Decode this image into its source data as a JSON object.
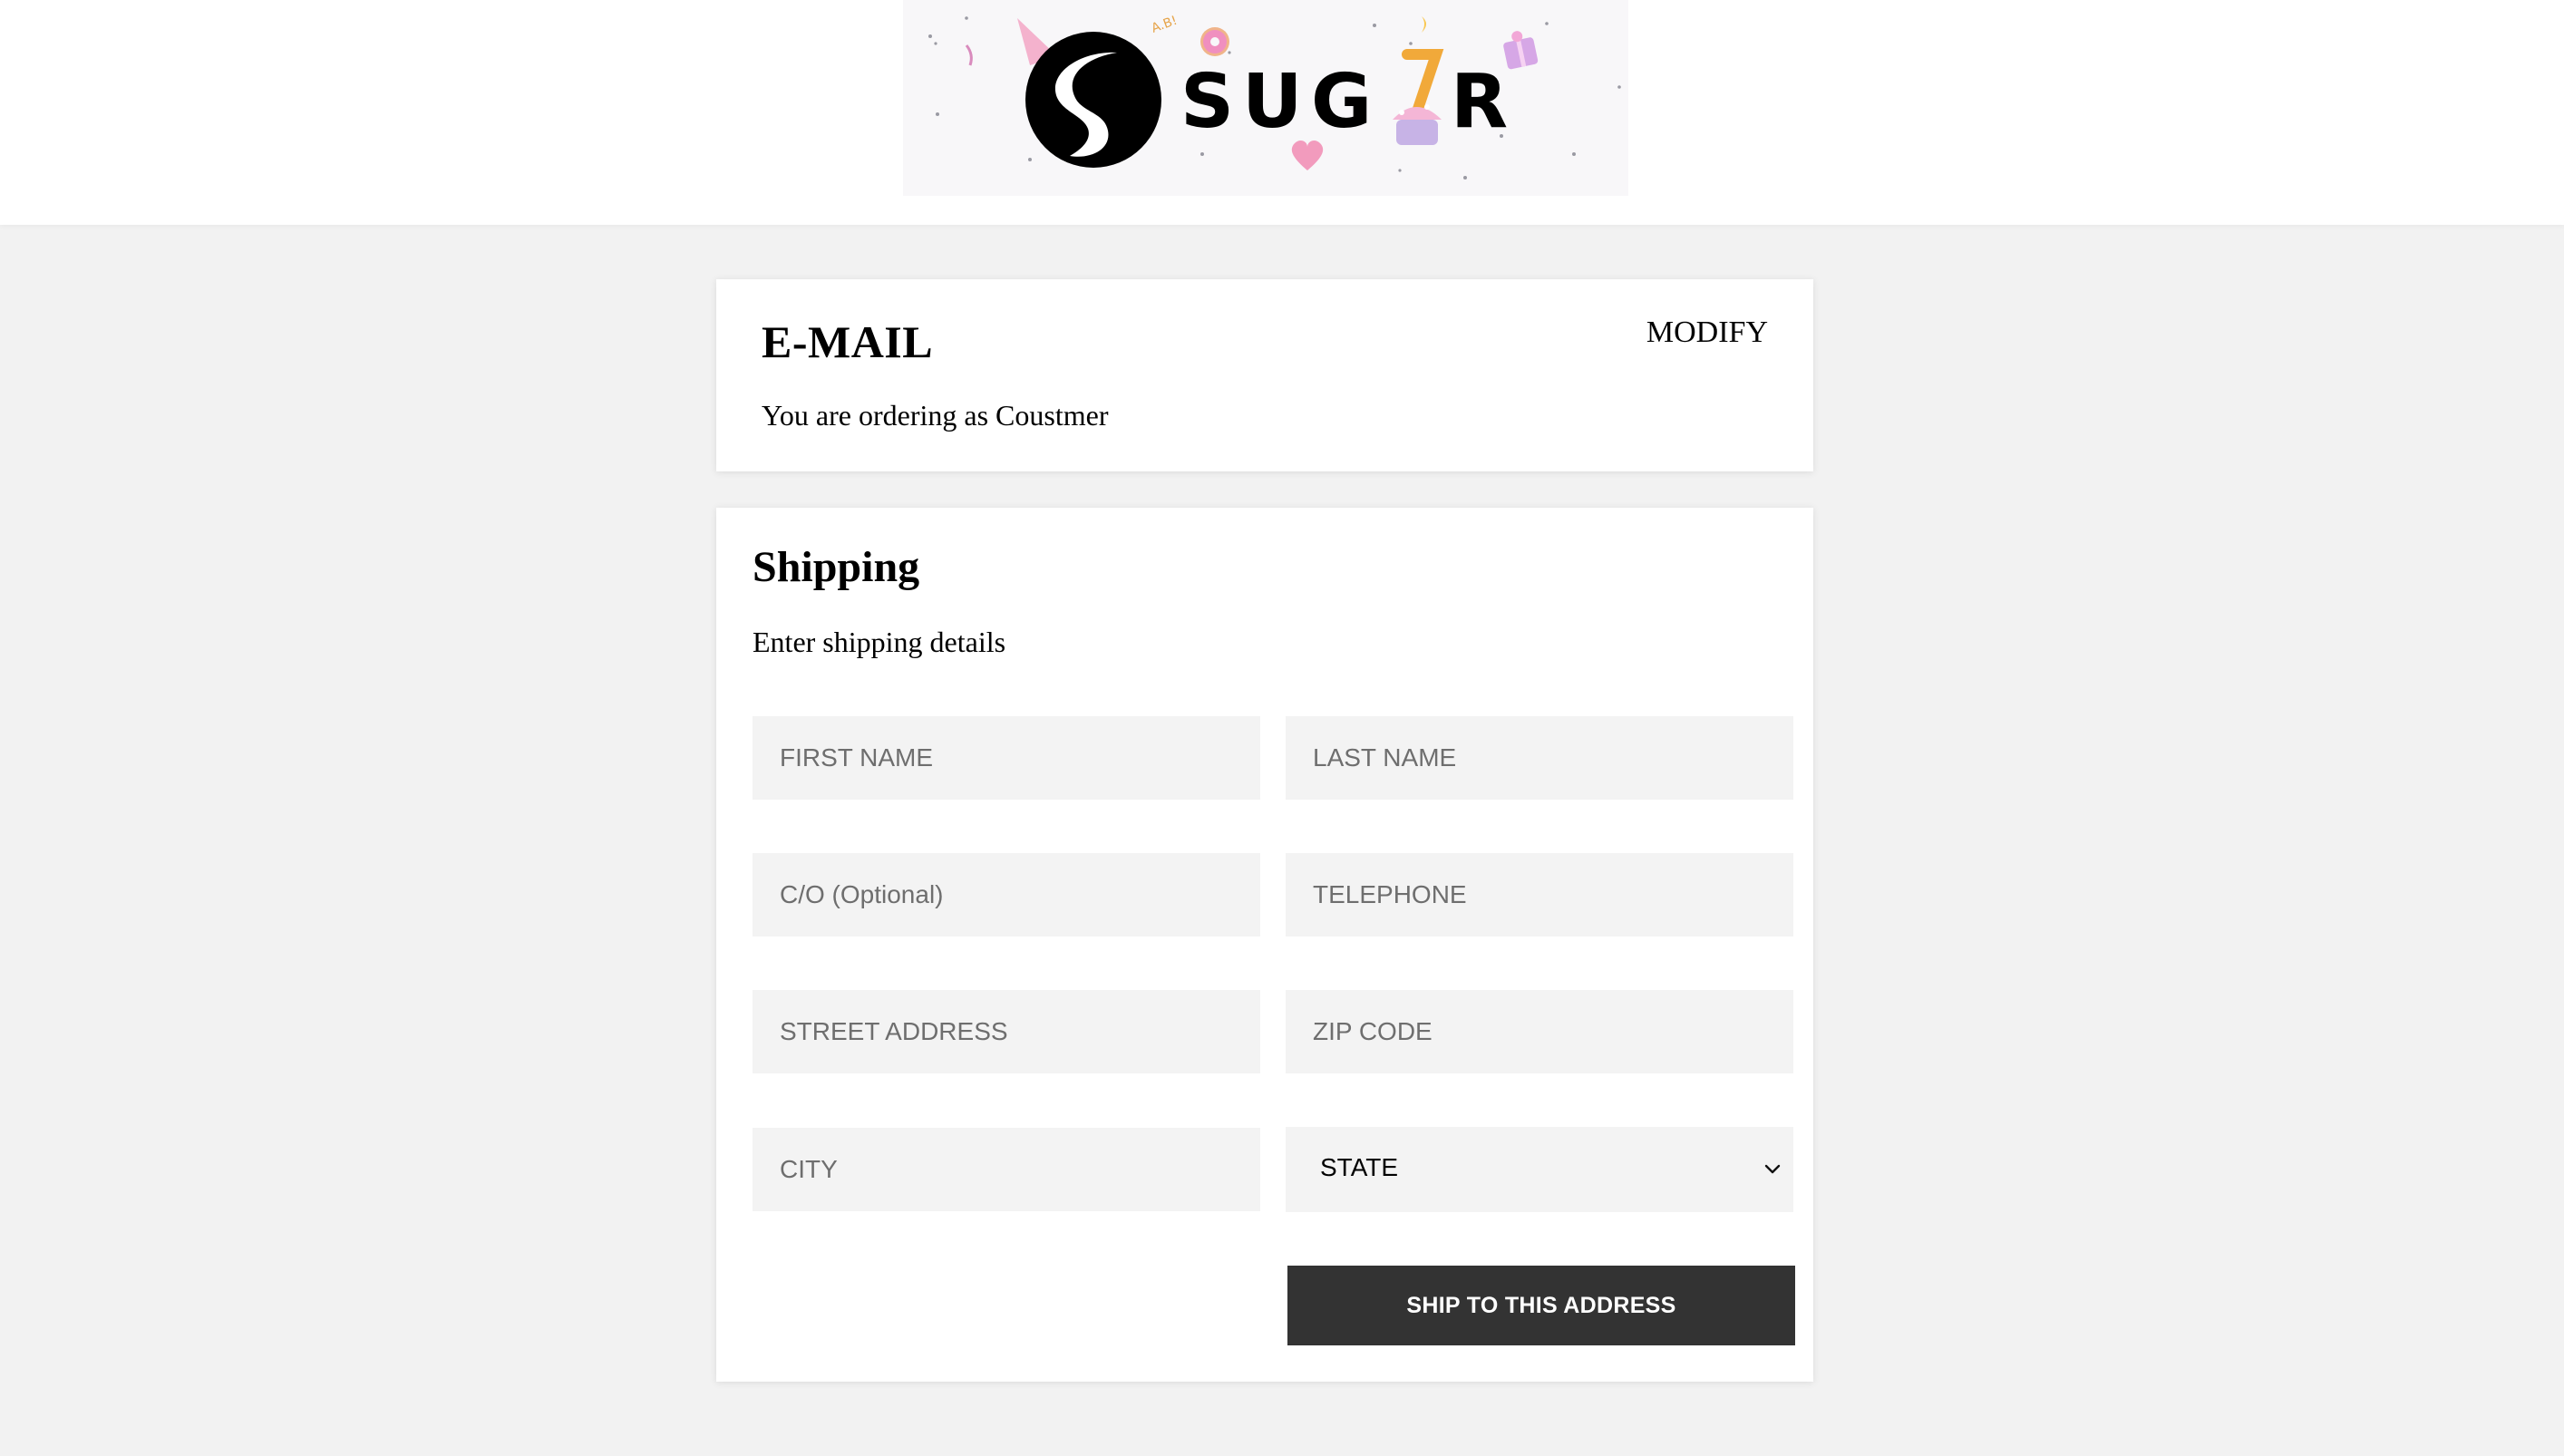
{
  "header": {
    "brand_letters": [
      "S",
      "U",
      "G",
      "R"
    ],
    "logo_alt": "SUGAR"
  },
  "email_section": {
    "title": "E-MAIL",
    "modify_label": "MODIFY",
    "subtitle": "You are ordering as Coustmer"
  },
  "shipping": {
    "title": "Shipping",
    "subtitle": "Enter shipping details",
    "fields": {
      "first_name": {
        "placeholder": "FIRST NAME",
        "value": ""
      },
      "last_name": {
        "placeholder": "LAST NAME",
        "value": ""
      },
      "care_of": {
        "placeholder": "C/O (Optional)",
        "value": ""
      },
      "telephone": {
        "placeholder": "TELEPHONE",
        "value": ""
      },
      "street": {
        "placeholder": "STREET ADDRESS",
        "value": ""
      },
      "zip": {
        "placeholder": "ZIP CODE",
        "value": ""
      },
      "city": {
        "placeholder": "CITY",
        "value": ""
      },
      "state": {
        "selected": "STATE"
      }
    },
    "submit_label": "SHIP TO THIS ADDRESS"
  },
  "icons": {
    "logo": "sugar-s-logo-icon",
    "select_arrow": "chevron-down-icon"
  },
  "colors": {
    "page_bg": "#f2f2f2",
    "card_bg": "#ffffff",
    "field_bg": "#f3f3f3",
    "button_bg": "#333333",
    "button_text": "#ffffff",
    "candle_accent": "#f1a93a",
    "decor_pink": "#f3a6c6",
    "decor_purple": "#b9a4dc"
  }
}
